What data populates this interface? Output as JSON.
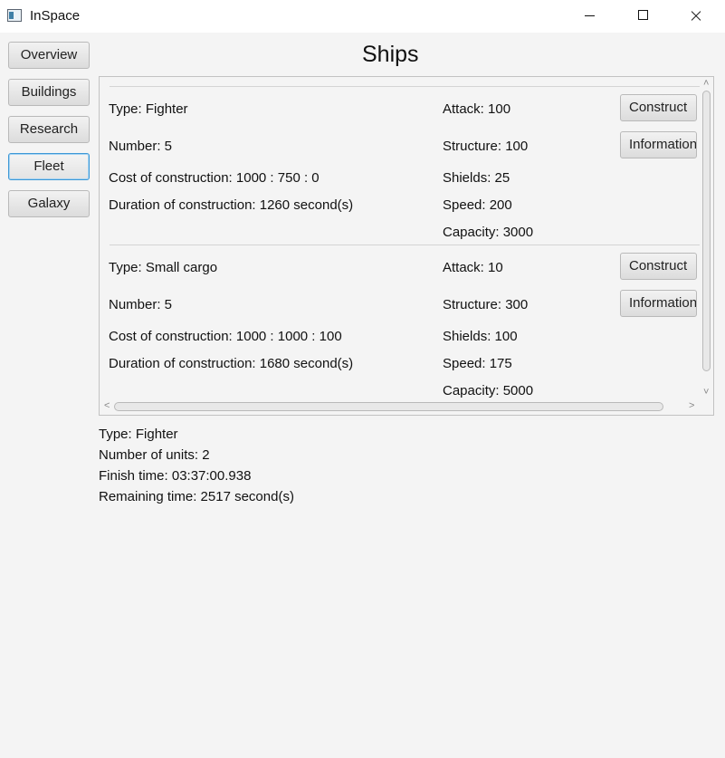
{
  "window": {
    "title": "InSpace",
    "icon": "app-window-icon"
  },
  "nav": {
    "items": [
      "Overview",
      "Buildings",
      "Research",
      "Fleet",
      "Galaxy"
    ],
    "active_index": 3
  },
  "page": {
    "title": "Ships"
  },
  "ships": [
    {
      "type": "Type: Fighter",
      "number": "Number: 5",
      "cost": "Cost of construction: 1000 : 750 : 0",
      "duration": "Duration of construction: 1260 second(s)",
      "attack": "Attack: 100",
      "structure": "Structure: 100",
      "shields": "Shields: 25",
      "speed": "Speed: 200",
      "capacity": "Capacity: 3000",
      "construct_label": "Construct",
      "info_label": "Information"
    },
    {
      "type": "Type: Small cargo",
      "number": "Number: 5",
      "cost": "Cost of construction: 1000 : 1000 : 100",
      "duration": "Duration of construction: 1680 second(s)",
      "attack": "Attack: 10",
      "structure": "Structure: 300",
      "shields": "Shields: 100",
      "speed": "Speed: 175",
      "capacity": "Capacity: 5000",
      "construct_label": "Construct",
      "info_label": "Information"
    }
  ],
  "queue": {
    "type": "Type: Fighter",
    "units": "Number of units: 2",
    "finish": "Finish time: 03:37:00.938",
    "remaining": "Remaining time: 2517 second(s)"
  },
  "scrollbar": {
    "up": "˄",
    "down": "˅",
    "left": "<",
    "right": ">"
  }
}
